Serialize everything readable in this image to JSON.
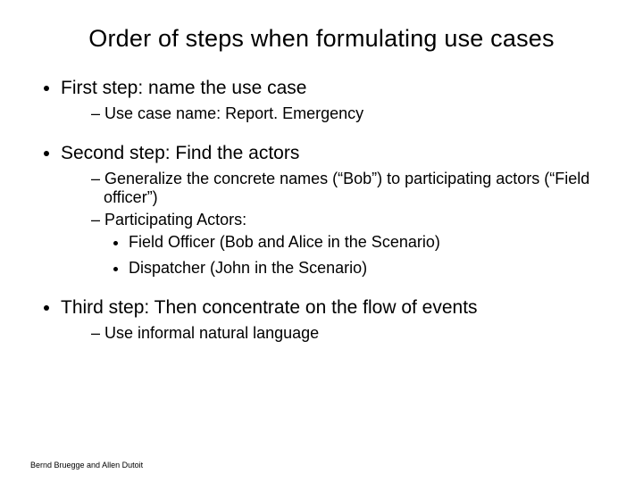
{
  "title": "Order of steps when formulating use cases",
  "step1": {
    "heading": "First step: name the use case",
    "sub1": "Use case name: Report. Emergency"
  },
  "step2": {
    "heading": "Second step: Find the actors",
    "sub1": "Generalize the concrete names (“Bob”) to participating actors (“Field officer”)",
    "sub2": "Participating Actors:",
    "actor1": "Field Officer (Bob and Alice in the Scenario)",
    "actor2": "Dispatcher (John in the Scenario)"
  },
  "step3": {
    "heading": "Third step: Then concentrate on  the flow of events",
    "sub1": "Use informal natural language"
  },
  "footer": "Bernd Bruegge and Allen Dutoit"
}
